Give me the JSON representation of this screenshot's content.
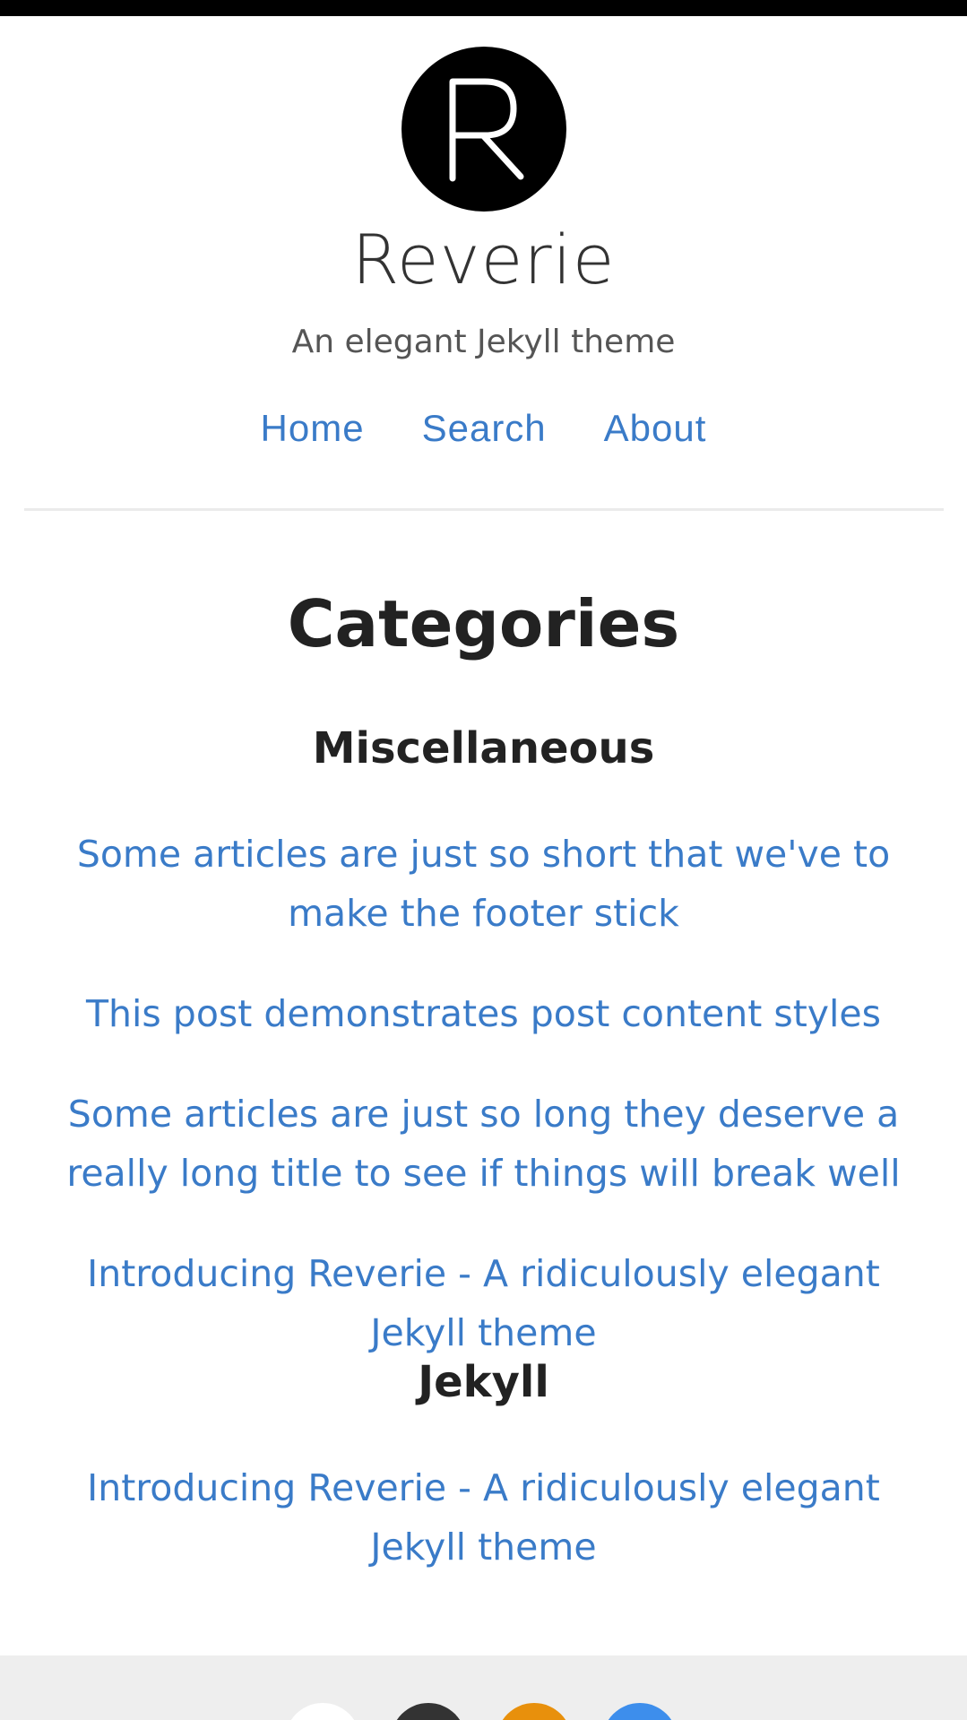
{
  "header": {
    "logo_letter": "R",
    "site_title": "Reverie",
    "tagline": "An elegant Jekyll theme"
  },
  "nav": {
    "items": [
      {
        "label": "Home"
      },
      {
        "label": "Search"
      },
      {
        "label": "About"
      }
    ]
  },
  "main": {
    "page_title": "Categories",
    "categories": [
      {
        "name": "Miscellaneous",
        "posts": [
          "Some articles are just so short that we've to make the footer stick",
          "This post demonstrates post content styles",
          "Some articles are just so long they deserve a really long title to see if things will break well",
          "Introducing Reverie - A ridiculously elegant Jekyll theme"
        ]
      },
      {
        "name": "Jekyll",
        "posts": [
          "Introducing Reverie - A ridiculously elegant Jekyll theme"
        ]
      }
    ]
  },
  "footer": {
    "social_icons": [
      {
        "icon": "social-icon-1",
        "color": "#ffffff"
      },
      {
        "icon": "social-icon-2",
        "color": "#333333"
      },
      {
        "icon": "social-icon-3",
        "color": "#e8900c"
      },
      {
        "icon": "social-icon-4",
        "color": "#3d8eec"
      }
    ]
  },
  "colors": {
    "link": "#3a7bc8",
    "heading": "#222222",
    "footer_bg": "#eeeeee"
  }
}
